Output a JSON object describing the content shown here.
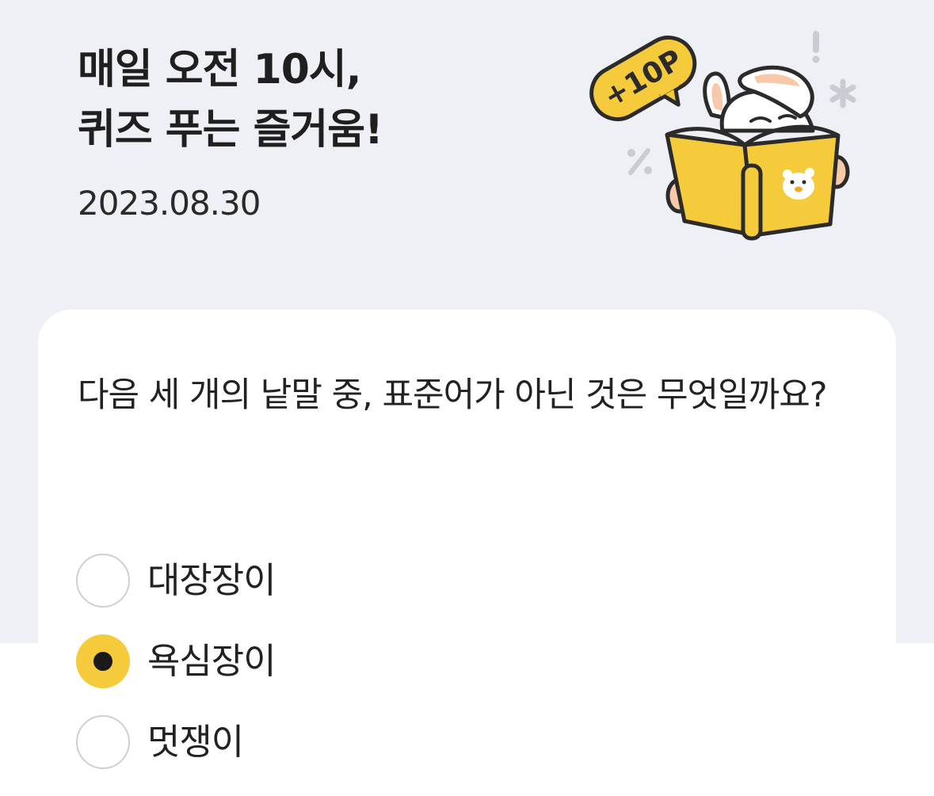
{
  "header": {
    "title_line1": "매일 오전 10시,",
    "title_line2": "퀴즈 푸는 즐거움!",
    "date": "2023.08.30"
  },
  "illustration": {
    "bubble_text": "+10P",
    "icon": "rabbit-reading-book"
  },
  "quiz": {
    "question": "다음 세 개의 낱말 중, 표준어가 아닌 것은 무엇일까요?",
    "options": [
      {
        "label": "대장장이",
        "selected": false
      },
      {
        "label": "욕심장이",
        "selected": true
      },
      {
        "label": "멋쟁이",
        "selected": false
      }
    ]
  },
  "colors": {
    "header_background": "#eef0f5",
    "accent_yellow": "#f5cb3c",
    "selected_dot": "#1a1a1a",
    "radio_border": "#cfcfcf"
  }
}
